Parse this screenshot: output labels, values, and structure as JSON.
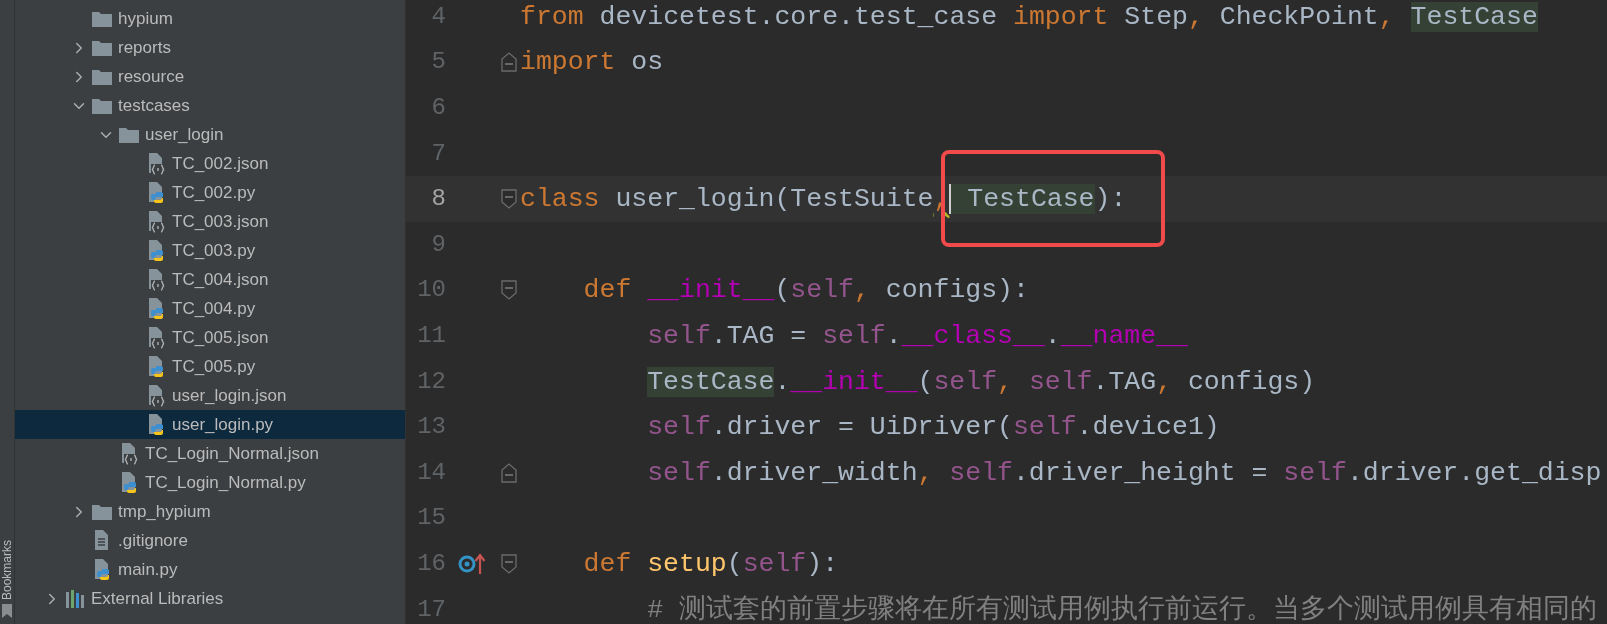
{
  "side_strip": {
    "label": "Bookmarks"
  },
  "project_tree": [
    {
      "label": "hypium",
      "kind": "folder",
      "selected": false
    },
    {
      "label": "reports",
      "kind": "folder",
      "expanded": false,
      "selected": false
    },
    {
      "label": "resource",
      "kind": "folder",
      "expanded": false,
      "selected": false
    },
    {
      "label": "testcases",
      "kind": "folder",
      "expanded": true,
      "selected": false,
      "children": [
        {
          "label": "user_login",
          "kind": "folder",
          "expanded": true,
          "selected": false,
          "children": [
            {
              "label": "TC_002.json",
              "kind": "json",
              "selected": false
            },
            {
              "label": "TC_002.py",
              "kind": "python",
              "selected": false
            },
            {
              "label": "TC_003.json",
              "kind": "json",
              "selected": false
            },
            {
              "label": "TC_003.py",
              "kind": "python",
              "selected": false
            },
            {
              "label": "TC_004.json",
              "kind": "json",
              "selected": false
            },
            {
              "label": "TC_004.py",
              "kind": "python",
              "selected": false
            },
            {
              "label": "TC_005.json",
              "kind": "json",
              "selected": false
            },
            {
              "label": "TC_005.py",
              "kind": "python",
              "selected": false
            },
            {
              "label": "user_login.json",
              "kind": "json",
              "selected": false
            },
            {
              "label": "user_login.py",
              "kind": "python",
              "selected": true
            }
          ]
        },
        {
          "label": "TC_Login_Normal.json",
          "kind": "json",
          "selected": false
        },
        {
          "label": "TC_Login_Normal.py",
          "kind": "python",
          "selected": false
        }
      ]
    },
    {
      "label": "tmp_hypium",
      "kind": "folder",
      "expanded": false,
      "selected": false
    },
    {
      "label": ".gitignore",
      "kind": "text",
      "selected": false
    },
    {
      "label": "main.py",
      "kind": "python",
      "selected": false
    }
  ],
  "external_libraries": {
    "label": "External Libraries",
    "expanded": false,
    "selected": false
  },
  "editor": {
    "lines": [
      {
        "number": "4",
        "current": false,
        "tokens": [
          {
            "text": "from",
            "kind": "keyword"
          },
          {
            "text": " devicetest.core.test_case ",
            "kind": "plain"
          },
          {
            "text": "import",
            "kind": "keyword"
          },
          {
            "text": " Step",
            "kind": "plain"
          },
          {
            "text": ",",
            "kind": "punct"
          },
          {
            "text": " CheckPoint",
            "kind": "plain"
          },
          {
            "text": ", ",
            "kind": "punct"
          },
          {
            "text": "TestCase",
            "kind": "match"
          }
        ]
      },
      {
        "number": "5",
        "current": false,
        "fold": {
          "kind": "end"
        },
        "tokens": [
          {
            "text": "import",
            "kind": "keyword"
          },
          {
            "text": " os",
            "kind": "plain"
          }
        ]
      },
      {
        "number": "6",
        "current": false
      },
      {
        "number": "7",
        "current": false
      },
      {
        "number": "8",
        "current": true,
        "fold": {
          "kind": "start"
        },
        "tokens": [
          {
            "text": "class",
            "kind": "keyword"
          },
          {
            "text": " user_login(TestSuite",
            "kind": "plain"
          },
          {
            "text": ",",
            "kind": "punct-warn"
          },
          {
            "text": " TestCase",
            "kind": "match-caret"
          },
          {
            "text": "):",
            "kind": "plain"
          }
        ]
      },
      {
        "number": "9",
        "current": false
      },
      {
        "number": "10",
        "current": false,
        "fold": {
          "kind": "start"
        },
        "indent": {
          "kind": "class-body"
        },
        "tokens": [
          {
            "text": "def",
            "kind": "keyword"
          },
          {
            "text": " __init__",
            "kind": "magic"
          },
          {
            "text": "(",
            "kind": "plain"
          },
          {
            "text": "self",
            "kind": "self"
          },
          {
            "text": ",",
            "kind": "punct"
          },
          {
            "text": " configs):",
            "kind": "plain"
          }
        ]
      },
      {
        "number": "11",
        "current": false,
        "indent": {
          "kind": "method-body"
        },
        "tokens": [
          {
            "text": "self",
            "kind": "self"
          },
          {
            "text": ".TAG = ",
            "kind": "plain"
          },
          {
            "text": "self",
            "kind": "self"
          },
          {
            "text": ".",
            "kind": "plain"
          },
          {
            "text": "__class__",
            "kind": "magic"
          },
          {
            "text": ".",
            "kind": "plain"
          },
          {
            "text": "__name__",
            "kind": "magic"
          }
        ]
      },
      {
        "number": "12",
        "current": false,
        "indent": {
          "kind": "method-body"
        },
        "tokens": [
          {
            "text": "TestCase",
            "kind": "match"
          },
          {
            "text": ".",
            "kind": "plain"
          },
          {
            "text": "__init__",
            "kind": "magic"
          },
          {
            "text": "(",
            "kind": "plain"
          },
          {
            "text": "self",
            "kind": "self"
          },
          {
            "text": ",",
            "kind": "punct"
          },
          {
            "text": " self",
            "kind": "self"
          },
          {
            "text": ".TAG",
            "kind": "plain"
          },
          {
            "text": ",",
            "kind": "punct"
          },
          {
            "text": " configs)",
            "kind": "plain"
          }
        ]
      },
      {
        "number": "13",
        "current": false,
        "indent": {
          "kind": "method-body"
        },
        "tokens": [
          {
            "text": "self",
            "kind": "self"
          },
          {
            "text": ".driver = UiDriver(",
            "kind": "plain"
          },
          {
            "text": "self",
            "kind": "self"
          },
          {
            "text": ".device1)",
            "kind": "plain"
          }
        ]
      },
      {
        "number": "14",
        "current": false,
        "fold": {
          "kind": "end"
        },
        "indent": {
          "kind": "method-body"
        },
        "tokens": [
          {
            "text": "self",
            "kind": "self"
          },
          {
            "text": ".driver_width",
            "kind": "plain"
          },
          {
            "text": ",",
            "kind": "punct"
          },
          {
            "text": " self",
            "kind": "self"
          },
          {
            "text": ".driver_height = ",
            "kind": "plain"
          },
          {
            "text": "self",
            "kind": "self"
          },
          {
            "text": ".driver.get_disp",
            "kind": "plain"
          }
        ]
      },
      {
        "number": "15",
        "current": false
      },
      {
        "number": "16",
        "current": false,
        "fold": {
          "kind": "start"
        },
        "marker": {
          "kind": "override"
        },
        "indent": {
          "kind": "class-body"
        },
        "tokens": [
          {
            "text": "def",
            "kind": "keyword"
          },
          {
            "text": " setup",
            "kind": "func"
          },
          {
            "text": "(",
            "kind": "plain"
          },
          {
            "text": "self",
            "kind": "self"
          },
          {
            "text": "):",
            "kind": "plain"
          }
        ]
      },
      {
        "number": "17",
        "current": false,
        "indent": {
          "kind": "method-body"
        },
        "tokens": [
          {
            "text": "# 测试套的前置步骤将在所有测试用例执行前运行。当多个测试用例具有相同的",
            "kind": "comment"
          }
        ]
      }
    ]
  }
}
